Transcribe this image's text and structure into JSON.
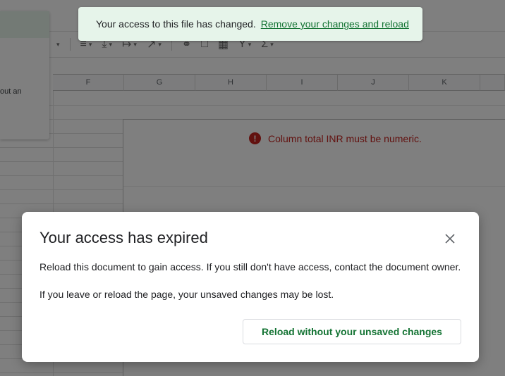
{
  "toast": {
    "message": "Your access to this file has changed.",
    "link": "Remove your changes and reload"
  },
  "side_panel": {
    "text": "out an"
  },
  "toolbar": {
    "icons": [
      "align-left-icon",
      "vertical-align-icon",
      "text-wrap-icon",
      "text-rotate-icon",
      "link-icon",
      "comment-icon",
      "chart-icon",
      "filter-icon",
      "functions-icon"
    ]
  },
  "grid": {
    "columns": [
      "F",
      "G",
      "H",
      "I",
      "J",
      "K"
    ]
  },
  "error": {
    "message": "Column total INR must be numeric."
  },
  "dialog": {
    "title": "Your access has expired",
    "text1": "Reload this document to gain access. If you still don't have access, contact the document owner.",
    "text2": "If you leave or reload the page, your unsaved changes may be lost.",
    "reload_button": "Reload without your unsaved changes"
  },
  "colors": {
    "accent_green": "#137333",
    "toast_bg": "#e6f4ea",
    "error_red": "#c5221f"
  }
}
